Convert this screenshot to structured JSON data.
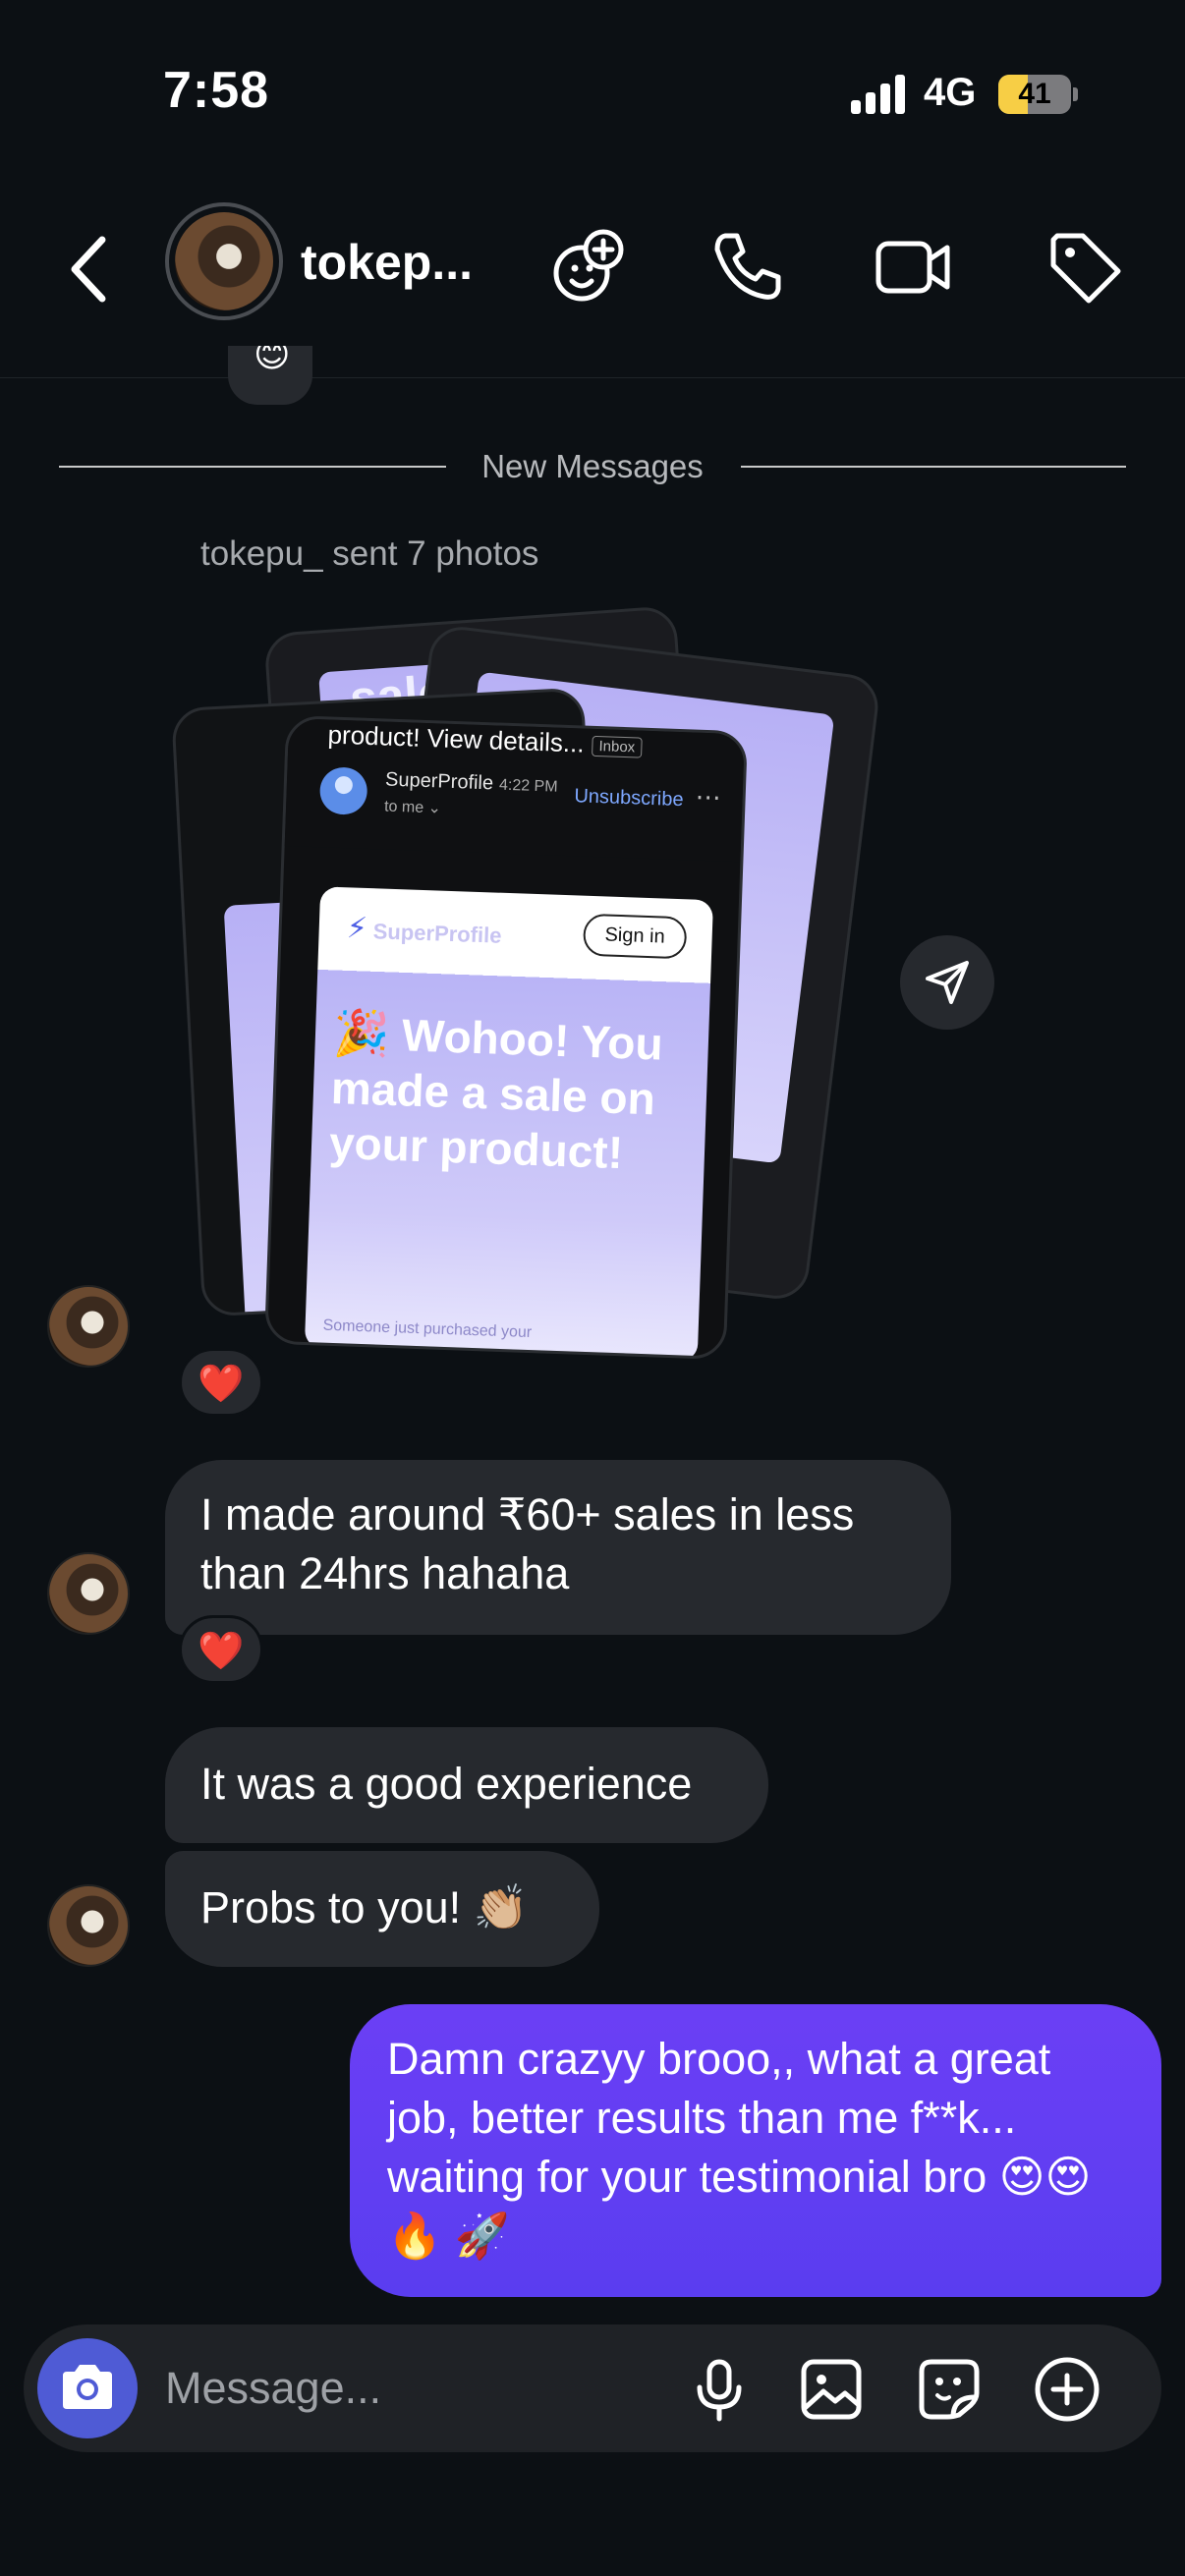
{
  "status_bar": {
    "time": "7:58",
    "network": "4G",
    "battery": "41",
    "battery_level": 0.41
  },
  "header": {
    "username": "tokep..."
  },
  "thread": {
    "divider_label": "New Messages",
    "photos_caption": "tokepu_ sent 7 photos",
    "photo_preview": {
      "back_text": "sale on your",
      "subject": "product! View details...",
      "inbox_tag": "Inbox",
      "sender": "SuperProfile",
      "sender_time": "4:22 PM",
      "to_me": "to me ⌄",
      "unsubscribe": "Unsubscribe",
      "brand": "SuperProfile",
      "sign_in": "Sign in",
      "headline": "🎉 Wohoo! You made a sale on your product!",
      "subline": "Someone just purchased your"
    },
    "messages": [
      {
        "from": "them",
        "text": "I made around ₹60+ sales in less than 24hrs hahaha",
        "reaction": "❤️"
      },
      {
        "from": "them",
        "text": "It was a good experience"
      },
      {
        "from": "them",
        "text": "Probs to you! 👏🏼"
      },
      {
        "from": "me",
        "text": "Damn crazyy brooo,, what a great job, better results than me f**k... waiting for your testimonial bro 😍😍 🔥 🚀"
      }
    ],
    "photo_reaction": "❤️",
    "peek_reaction": "😊"
  },
  "composer": {
    "placeholder": "Message..."
  },
  "colors": {
    "background": "#0c1014",
    "incoming_bubble": "#26292e",
    "outgoing_bubble": "#5a3df0",
    "camera_button": "#4f5bd5"
  },
  "icons": [
    "back-chevron-icon",
    "add-emoji-icon",
    "phone-icon",
    "video-icon",
    "tag-icon",
    "send-icon",
    "camera-icon",
    "microphone-icon",
    "gallery-icon",
    "sticker-icon",
    "plus-circle-icon"
  ]
}
